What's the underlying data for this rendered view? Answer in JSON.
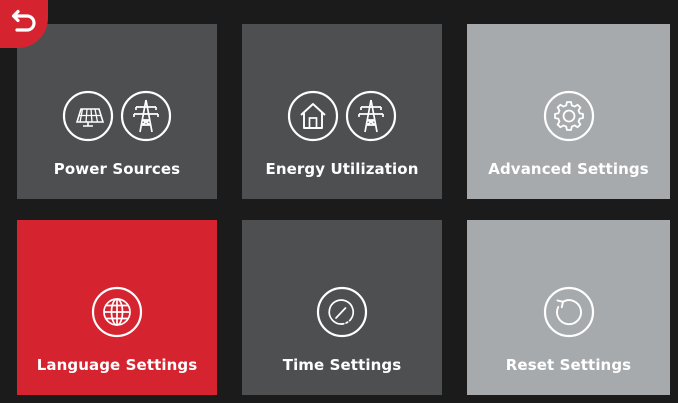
{
  "colors": {
    "background": "#1b1b1b",
    "tile_dark": "#4e4f51",
    "tile_light": "#a7aaad",
    "tile_active": "#d62330",
    "back_button": "#d62330"
  },
  "back_button": {
    "icon": "back-arrow-icon"
  },
  "tiles": [
    {
      "label": "Power Sources",
      "icons": [
        "solar-panel-icon",
        "power-tower-icon"
      ],
      "state": "dark"
    },
    {
      "label": "Energy Utilization",
      "icons": [
        "home-icon",
        "power-tower-icon"
      ],
      "state": "dark"
    },
    {
      "label": "Advanced Settings",
      "icons": [
        "gear-icon"
      ],
      "state": "light"
    },
    {
      "label": "Language Settings",
      "icons": [
        "globe-icon"
      ],
      "state": "active"
    },
    {
      "label": "Time Settings",
      "icons": [
        "clock-gauge-icon"
      ],
      "state": "dark"
    },
    {
      "label": "Reset Settings",
      "icons": [
        "reset-icon"
      ],
      "state": "light"
    }
  ]
}
